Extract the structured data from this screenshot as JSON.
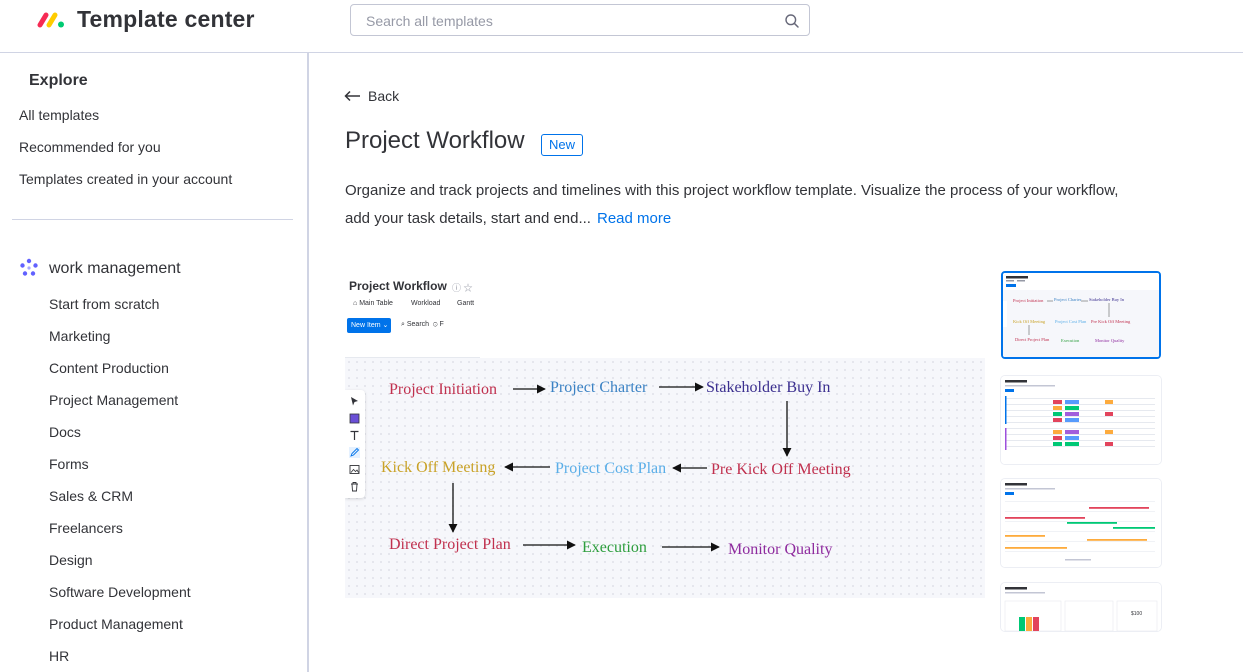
{
  "header": {
    "app_title": "Template center",
    "search_placeholder": "Search all templates"
  },
  "sidebar": {
    "explore_title": "Explore",
    "top_items": [
      {
        "label": "All templates"
      },
      {
        "label": "Recommended for you"
      },
      {
        "label": "Templates created in your account"
      }
    ],
    "section_label": "work management",
    "sub_items": [
      {
        "label": "Start from scratch"
      },
      {
        "label": "Marketing"
      },
      {
        "label": "Content Production"
      },
      {
        "label": "Project Management"
      },
      {
        "label": "Docs"
      },
      {
        "label": "Forms"
      },
      {
        "label": "Sales & CRM"
      },
      {
        "label": "Freelancers"
      },
      {
        "label": "Design"
      },
      {
        "label": "Software Development"
      },
      {
        "label": "Product Management"
      },
      {
        "label": "HR"
      }
    ]
  },
  "main": {
    "back_label": "Back",
    "title": "Project Workflow",
    "badge": "New",
    "description": "Organize and track projects and timelines with this project workflow template. Visualize the process of your workflow, add your task details, start and end...",
    "read_more": "Read more"
  },
  "preview": {
    "board_title": "Project Workflow",
    "tabs": [
      "Main Table",
      "Workload",
      "Gantt"
    ],
    "new_item_label": "New Item",
    "search_label": "Search",
    "flow_nodes": [
      {
        "label": "Project Initiation",
        "color": "#c0304e"
      },
      {
        "label": "Project Charter",
        "color": "#3b82c4"
      },
      {
        "label": "Stakeholder Buy In",
        "color": "#3b2f8f"
      },
      {
        "label": "Pre Kick Off Meeting",
        "color": "#c0304e"
      },
      {
        "label": "Project Cost Plan",
        "color": "#5aaee8"
      },
      {
        "label": "Kick Off Meeting",
        "color": "#c9a227"
      },
      {
        "label": "Direct Project Plan",
        "color": "#c0304e"
      },
      {
        "label": "Execution",
        "color": "#2e9e3e"
      },
      {
        "label": "Monitor Quality",
        "color": "#8e2a9e"
      }
    ]
  },
  "colors": {
    "accent": "#0073ea",
    "text": "#323338",
    "border": "#d0d4e4"
  }
}
